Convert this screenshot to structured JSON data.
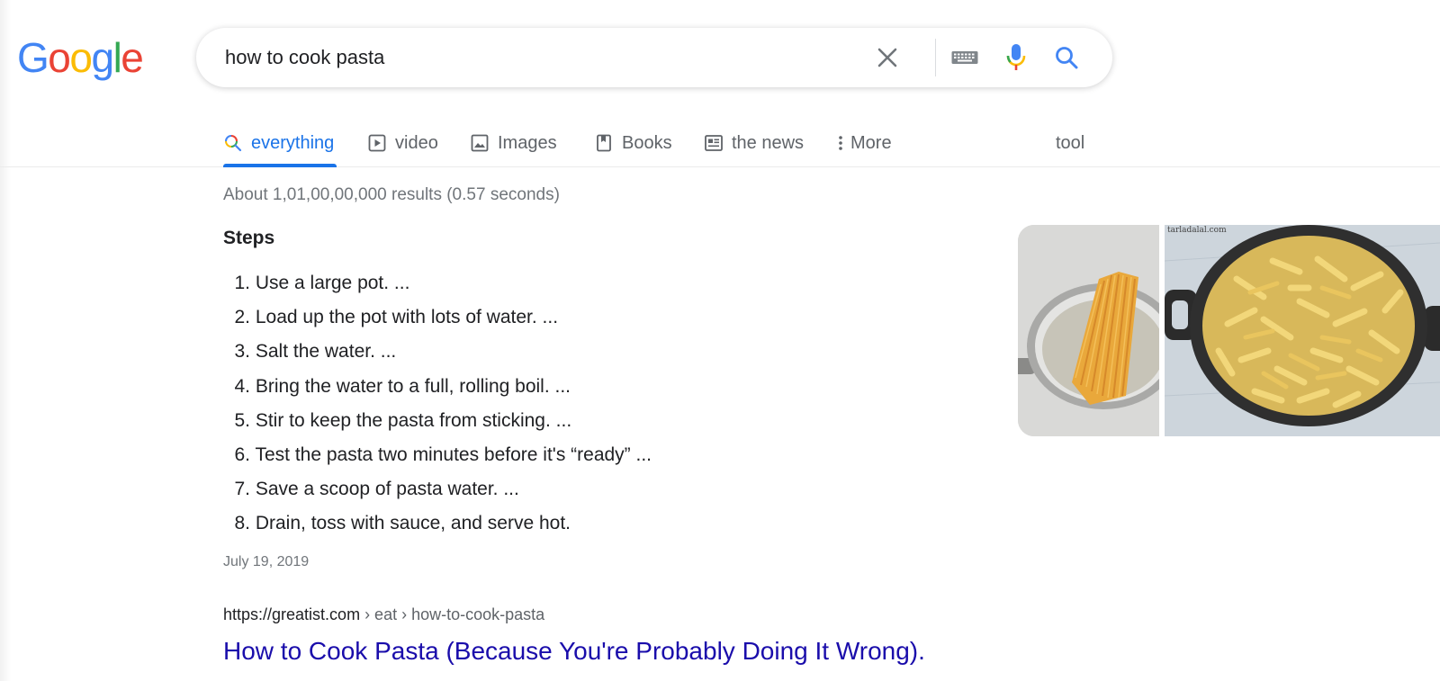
{
  "logo": {
    "text": "Google"
  },
  "search": {
    "query": "how to cook pasta"
  },
  "icons": {
    "clear": "close-icon",
    "keyboard": "keyboard-icon",
    "mic": "microphone-icon",
    "search": "search-icon"
  },
  "tabs": [
    {
      "label": "everything",
      "icon": "search-icon",
      "active": true
    },
    {
      "label": "video",
      "icon": "video-icon"
    },
    {
      "label": "Images",
      "icon": "image-icon"
    },
    {
      "label": "Books",
      "icon": "book-icon"
    },
    {
      "label": "the news",
      "icon": "news-icon"
    },
    {
      "label": "More",
      "icon": "more-vert-icon"
    }
  ],
  "tools_label": "tool",
  "result_stats": "About 1,01,00,00,000 results (0.57 seconds)",
  "snippet": {
    "heading": "Steps",
    "steps": [
      {
        "num": "1.",
        "text": "Use a large pot. ..."
      },
      {
        "num": "2.",
        "text": "Load up the pot with lots of water. ..."
      },
      {
        "num": "3.",
        "text": "Salt the water. ..."
      },
      {
        "num": "4.",
        "text": "Bring the water to a full, rolling boil. ..."
      },
      {
        "num": "5.",
        "text": "Stir to keep the pasta from sticking. ..."
      },
      {
        "num": "6.",
        "text": "Test the pasta two minutes before it's “ready” ..."
      },
      {
        "num": "7.",
        "text": "Save a scoop of pasta water. ..."
      },
      {
        "num": "8.",
        "text": "Drain, toss with sauce, and serve hot."
      }
    ],
    "date": "July 19, 2019"
  },
  "result": {
    "url_base": "https://greatist.com",
    "url_path": " › eat › how-to-cook-pasta",
    "title": "How to Cook Pasta (Because You're Probably Doing It Wrong)."
  },
  "images": {
    "watermark": "tarladalal.com"
  },
  "colors": {
    "link": "#1a0dab",
    "accent": "#1a73e8",
    "text": "#202124",
    "muted": "#70757a"
  }
}
